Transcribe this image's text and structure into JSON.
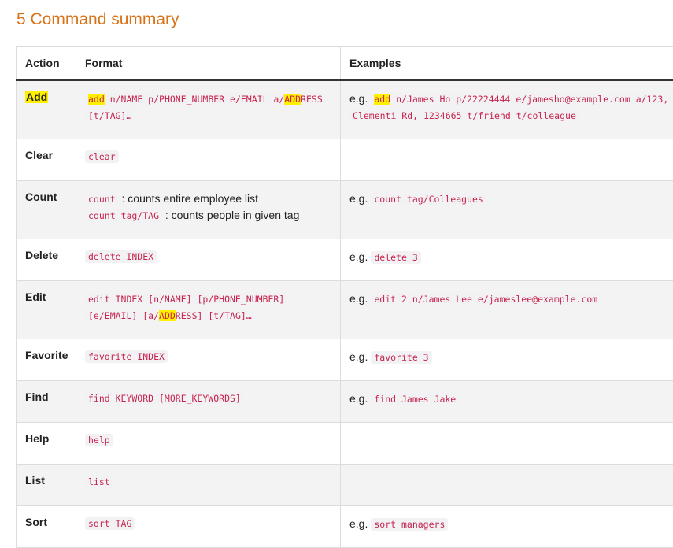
{
  "title": "5 Command summary",
  "headers": {
    "action": "Action",
    "format": "Format",
    "examples": "Examples"
  },
  "colors": {
    "title": "#d9731a",
    "code_text": "#c7254e",
    "highlight": "#ffef00"
  },
  "eg_prefix": "e.g.",
  "rows": {
    "add": {
      "action": "Add",
      "format_cmd": "add",
      "format_mid": " n/NAME p/PHONE_NUMBER e/EMAIL a/",
      "format_hl": "ADD",
      "format_end_1": "RESS",
      "format_end_2": "[t/TAG]…",
      "example_cmd": "add",
      "example_line1": " n/James Ho p/22224444 e/jamesho@example.com a/123,",
      "example_line2": "Clementi Rd, 1234665 t/friend t/colleague"
    },
    "clear": {
      "action": "Clear",
      "format": "clear"
    },
    "count": {
      "action": "Count",
      "format_code1": "count",
      "format_text1": " : counts entire employee list",
      "format_code2": "count tag/TAG",
      "format_text2": " : counts people in given tag",
      "example": "count tag/Colleagues"
    },
    "delete": {
      "action": "Delete",
      "format": "delete INDEX",
      "example": "delete 3"
    },
    "edit": {
      "action": "Edit",
      "format_line1": "edit INDEX [n/NAME] [p/PHONE_NUMBER]",
      "format_line2_a": "[e/EMAIL] [a/",
      "format_hl": "ADD",
      "format_line2_b": "RESS] [t/TAG]…",
      "example": "edit 2 n/James Lee e/jameslee@example.com"
    },
    "favorite": {
      "action": "Favorite",
      "format": "favorite INDEX",
      "example": "favorite 3"
    },
    "find": {
      "action": "Find",
      "format": "find KEYWORD [MORE_KEYWORDS]",
      "example": "find James Jake"
    },
    "help": {
      "action": "Help",
      "format": "help"
    },
    "list": {
      "action": "List",
      "format": "list"
    },
    "sort": {
      "action": "Sort",
      "format": "sort TAG",
      "example": "sort managers"
    }
  }
}
